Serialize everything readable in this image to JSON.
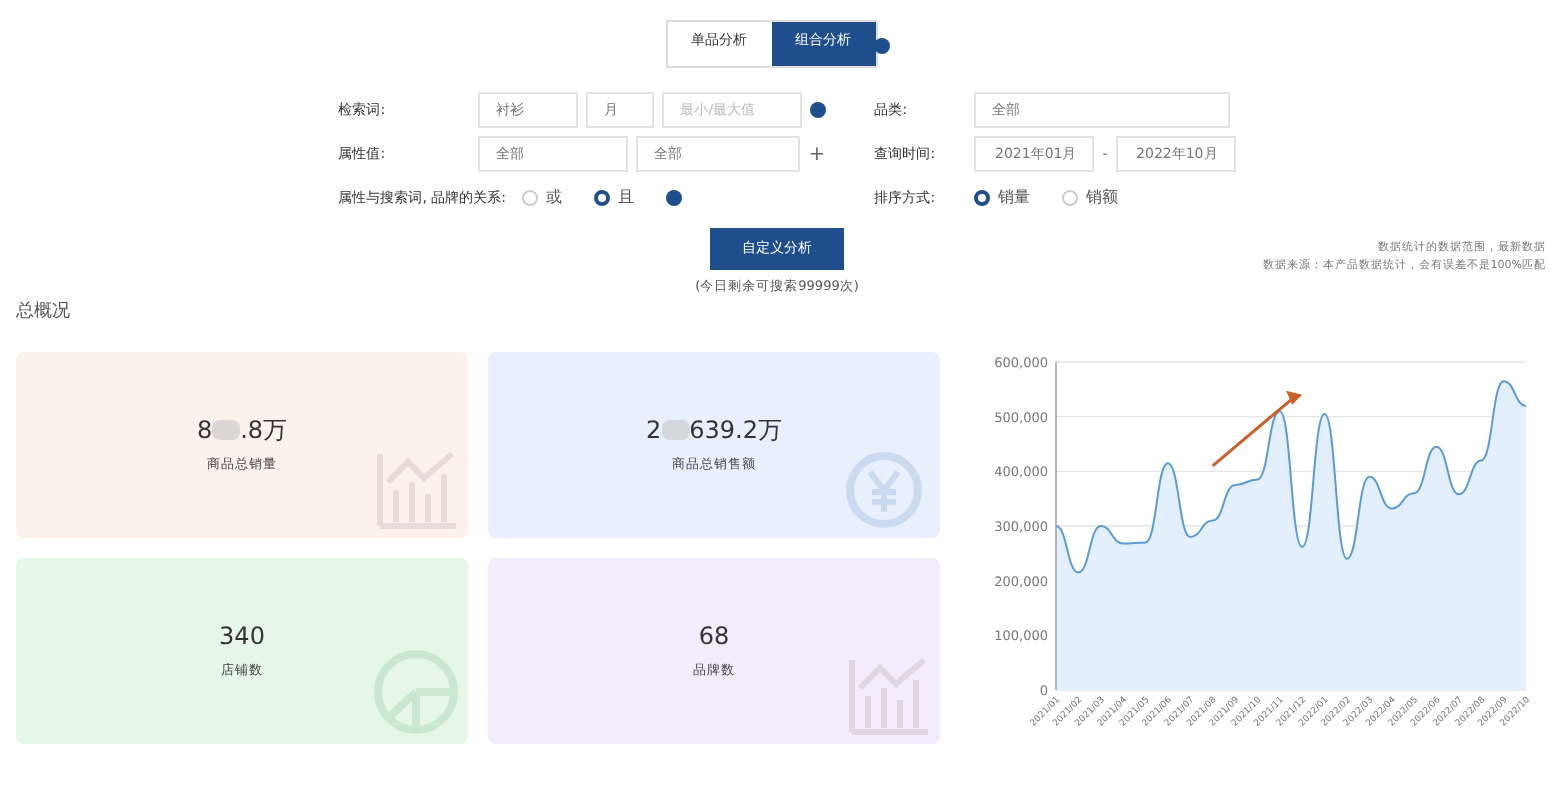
{
  "tabs": [
    {
      "label": "单品分析",
      "selected": false
    },
    {
      "label": "组合分析",
      "selected": true
    }
  ],
  "form": {
    "left": [
      {
        "kind": "keyword",
        "label": "检索词:",
        "value": "衬衫",
        "unit": "月",
        "placeholder": "最小/最大值"
      },
      {
        "kind": "attr",
        "label": "属性值:",
        "select_1": "全部",
        "select_2": "全部",
        "add": "+"
      },
      {
        "kind": "radio",
        "label": "属性与搜索词, 品牌的关系:",
        "options": [
          {
            "label": "或",
            "selected": false
          },
          {
            "label": "且",
            "selected": true
          }
        ]
      }
    ],
    "right": [
      {
        "kind": "select",
        "label": "品类:",
        "value": "全部"
      },
      {
        "kind": "range",
        "label": "查询时间:",
        "from": "2021年01月",
        "sep": "-",
        "to": "2022年10月"
      },
      {
        "kind": "radio",
        "label": "排序方式:",
        "options": [
          {
            "label": "销量",
            "selected": true
          },
          {
            "label": "销额",
            "selected": false
          }
        ]
      }
    ],
    "button": "自定义分析",
    "quota": "(今日剩余可搜索99999次)"
  },
  "overview": {
    "title": "总概况",
    "cards": [
      {
        "value_parts": [
          "8",
          ".8万"
        ],
        "label": "商品总销量",
        "color": "#fdf1eb"
      },
      {
        "value_parts": [
          "2",
          "639.2万"
        ],
        "label": "商品总销售额",
        "color": "#e9f0fd"
      },
      {
        "value_parts": [
          "340"
        ],
        "label": "店铺数",
        "color": "#e6f7e8"
      },
      {
        "value_parts": [
          "68"
        ],
        "label": "品牌数",
        "color": "#f3ecfd"
      }
    ]
  },
  "chart_panel": {
    "notes": [
      "数据统计的数据范围，最新数据",
      "数据来源：本产品数据统计，会有误差不是100%匹配"
    ],
    "chart_data": {
      "type": "area",
      "categories": [
        "2021/01",
        "2021/02",
        "2021/03",
        "2021/04",
        "2021/05",
        "2021/06",
        "2021/07",
        "2021/08",
        "2021/09",
        "2021/10",
        "2021/11",
        "2021/12",
        "2022/01",
        "2022/02",
        "2022/03",
        "2022/04",
        "2022/05",
        "2022/06",
        "2022/07",
        "2022/08",
        "2022/09",
        "2022/10"
      ],
      "series": [
        {
          "color": "#5b9bd5",
          "values": [
            300000,
            215000,
            300000,
            268000,
            270000,
            415000,
            280000,
            310000,
            375000,
            385000,
            510000,
            262000,
            505000,
            240000,
            390000,
            332000,
            360000,
            445000,
            358000,
            420000,
            565000,
            520000
          ]
        }
      ],
      "ylim": [
        0,
        600000
      ],
      "yticks": [
        {
          "value": 0,
          "label": "0"
        },
        {
          "value": 100000,
          "label": "100,000"
        },
        {
          "value": 200000,
          "label": "200,000"
        },
        {
          "value": 300000,
          "label": "300,000"
        },
        {
          "value": 400000,
          "label": "400,000"
        },
        {
          "value": 500000,
          "label": "500,000"
        },
        {
          "value": 600000,
          "label": "600,000"
        }
      ],
      "grid": true
    }
  }
}
